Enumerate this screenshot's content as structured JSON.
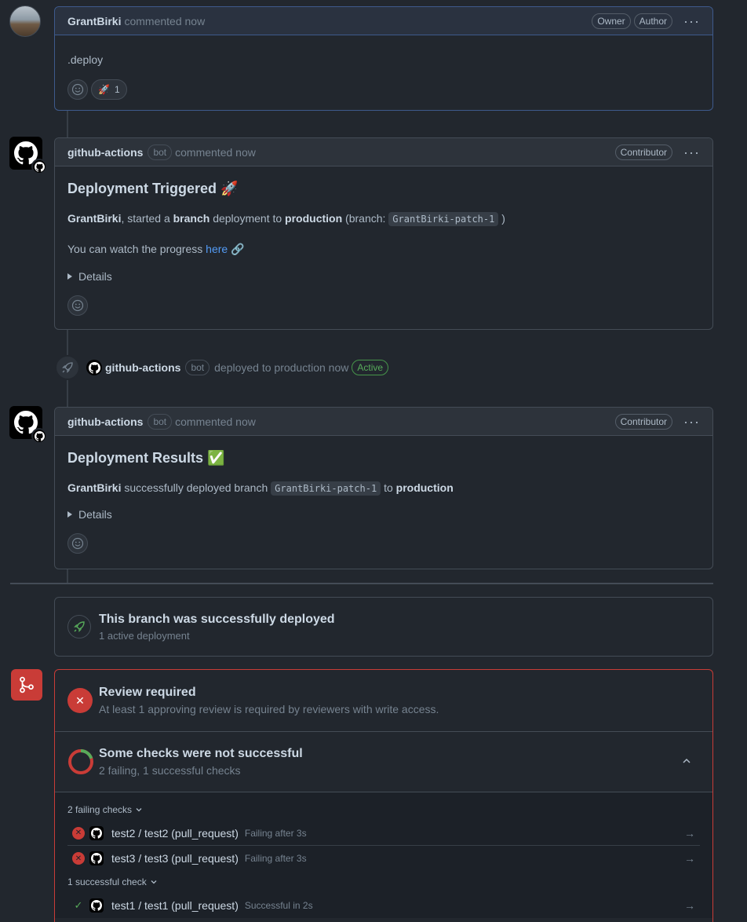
{
  "comment1": {
    "author": "GrantBirki",
    "meta": "commented now",
    "labels": [
      "Owner",
      "Author"
    ],
    "body": ".deploy",
    "reaction": {
      "emoji": "🚀",
      "count": "1"
    }
  },
  "comment2": {
    "author": "github-actions",
    "bot": "bot",
    "meta": "commented now",
    "label": "Contributor",
    "heading": "Deployment Triggered 🚀",
    "line1": {
      "user": "GrantBirki",
      "t1": ", started a ",
      "kind": "branch",
      "t2": " deployment to ",
      "env": "production",
      "t3": " (branch: ",
      "branch": "GrantBirki-patch-1",
      "t4": " )"
    },
    "line2": {
      "t1": "You can watch the progress ",
      "link": "here",
      "t2": " 🔗"
    },
    "details": "Details"
  },
  "event": {
    "actor": "github-actions",
    "bot": "bot",
    "text": "deployed to production now",
    "badge": "Active"
  },
  "comment3": {
    "author": "github-actions",
    "bot": "bot",
    "meta": "commented now",
    "label": "Contributor",
    "heading": "Deployment Results ✅",
    "line1": {
      "user": "GrantBirki",
      "t1": " successfully deployed branch ",
      "branch": "GrantBirki-patch-1",
      "t2": " to ",
      "env": "production"
    },
    "details": "Details"
  },
  "deploy_box": {
    "title": "This branch was successfully deployed",
    "subtitle": "1 active deployment"
  },
  "merge": {
    "review_title": "Review required",
    "review_sub": "At least 1 approving review is required by reviewers with write access.",
    "checks_title": "Some checks were not successful",
    "checks_sub": "2 failing, 1 successful checks",
    "failing_label": "2 failing checks",
    "success_label": "1 successful check",
    "failing": [
      {
        "name": "test2 / test2 (pull_request)",
        "status": "Failing after 3s"
      },
      {
        "name": "test3 / test3 (pull_request)",
        "status": "Failing after 3s"
      }
    ],
    "successful": [
      {
        "name": "test1 / test1 (pull_request)",
        "status": "Successful in 2s"
      }
    ]
  },
  "colors": {
    "accent": "#539bf5",
    "danger": "#c93c37",
    "success": "#57ab5a",
    "bg": "#22272e"
  }
}
